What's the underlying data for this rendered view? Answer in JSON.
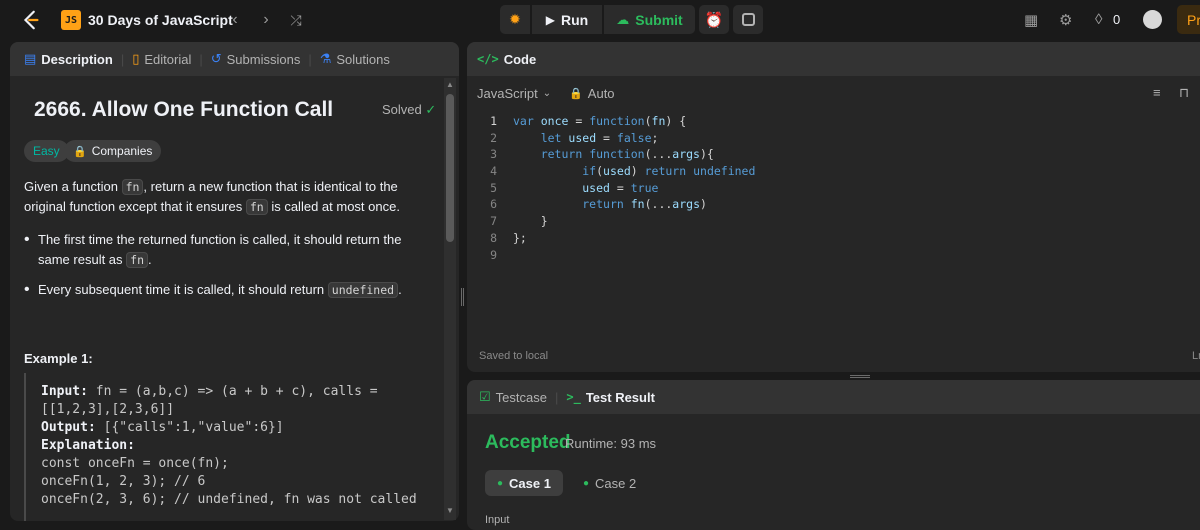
{
  "topbar": {
    "list_badge": "JS",
    "list_title": "30 Days of JavaScript",
    "run_label": "Run",
    "submit_label": "Submit",
    "streak_count": "0",
    "premium_label": "Pr"
  },
  "left_panel": {
    "tabs": [
      {
        "label": "Description"
      },
      {
        "label": "Editorial"
      },
      {
        "label": "Submissions"
      },
      {
        "label": "Solutions"
      }
    ],
    "problem_title": "2666. Allow One Function Call",
    "solved_label": "Solved",
    "difficulty": "Easy",
    "companies_label": "Companies",
    "statement": {
      "p1": "Given a function ",
      "p1_code": "fn",
      "p2": ", return a new function that is identical to the original function except that it ensures ",
      "p2_code": "fn",
      "p3": " is called at most once."
    },
    "bullets": [
      {
        "text": "The first time the returned function is called, it should return the same result as ",
        "code": "fn",
        "tail": "."
      },
      {
        "text": "Every subsequent time it is called, it should return ",
        "code": "undefined",
        "tail": "."
      }
    ],
    "example_title": "Example 1:",
    "example": {
      "input_label": "Input:",
      "input_value": " fn = (a,b,c) => (a + b + c), calls = [[1,2,3],[2,3,6]]",
      "output_label": "Output:",
      "output_value": " [{\"calls\":1,\"value\":6}]",
      "explanation_label": "Explanation:",
      "lines": [
        "const onceFn = once(fn);",
        "onceFn(1, 2, 3); // 6",
        "onceFn(2, 3, 6); // undefined, fn was not called"
      ]
    }
  },
  "code_panel": {
    "title": "Code",
    "language": "JavaScript",
    "mode": "Auto",
    "saved_label": "Saved to local",
    "right_clip": "Ln",
    "line_numbers": [
      "1",
      "2",
      "3",
      "4",
      "5",
      "6",
      "7",
      "8",
      "9"
    ]
  },
  "test_panel": {
    "tab_testcase": "Testcase",
    "tab_result": "Test Result",
    "status": "Accepted",
    "runtime": "Runtime: 93 ms",
    "cases": [
      "Case 1",
      "Case 2"
    ],
    "input_label": "Input"
  },
  "colors": {
    "accent_orange": "#ffa116",
    "accepted_green": "#2cbb5d",
    "panel_bg": "#262626",
    "tab_bar_bg": "#333333"
  }
}
